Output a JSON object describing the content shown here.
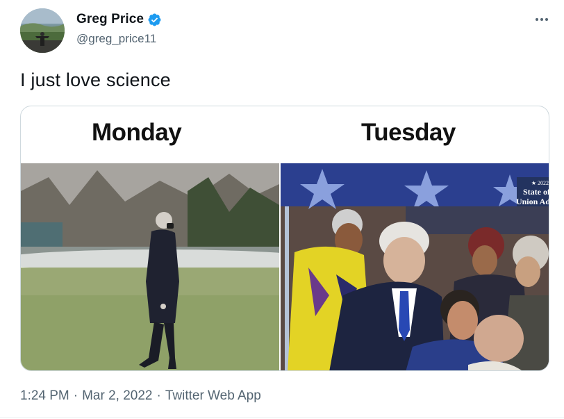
{
  "author": {
    "display_name": "Greg Price",
    "handle": "@greg_price11",
    "verified": true,
    "verified_color": "#1d9bf0"
  },
  "tweet": {
    "text": "I just love science",
    "media": {
      "left_label": "Monday",
      "right_label": "Tuesday",
      "right_photo_caption": [
        "★ 2022",
        "State of",
        "Union Ad"
      ]
    }
  },
  "meta": {
    "time": "1:24 PM",
    "separator": "·",
    "date": "Mar 2, 2022",
    "source": "Twitter Web App"
  },
  "icons": {
    "more": "more-horizontal-icon",
    "verified": "verified-badge-icon"
  },
  "colors": {
    "text_primary": "#0f1419",
    "text_secondary": "#536471",
    "border": "#cfd9de"
  }
}
